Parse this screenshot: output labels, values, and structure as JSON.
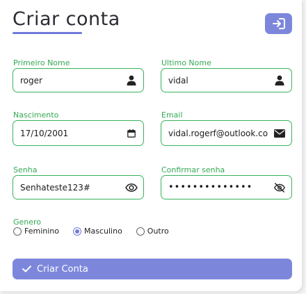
{
  "header": {
    "title": "Criar conta",
    "login_icon": "sign-in-icon"
  },
  "form": {
    "first_name": {
      "label": "Primeiro Nome",
      "value": "roger",
      "icon": "user-icon"
    },
    "last_name": {
      "label": "Ultimo Nome",
      "value": "vidal",
      "icon": "user-icon"
    },
    "birth": {
      "label": "Nascimento",
      "value": "17/10/2001",
      "icon": "calendar-icon"
    },
    "email": {
      "label": "Email",
      "value": "vidal.rogerf@outlook.co",
      "icon": "envelope-icon"
    },
    "password": {
      "label": "Senha",
      "value": "Senhateste123#",
      "icon": "eye-icon"
    },
    "confirm_password": {
      "label": "Confirmar senha",
      "value": "••••••••••••••",
      "icon": "eye-slash-icon"
    },
    "gender": {
      "label": "Genero",
      "options": [
        "Feminino",
        "Masculino",
        "Outro"
      ],
      "selected": "Masculino"
    },
    "submit_label": "Criar Conta"
  },
  "colors": {
    "accent": "#7c87dc",
    "field_border": "#37b35a",
    "label": "#34a853"
  }
}
